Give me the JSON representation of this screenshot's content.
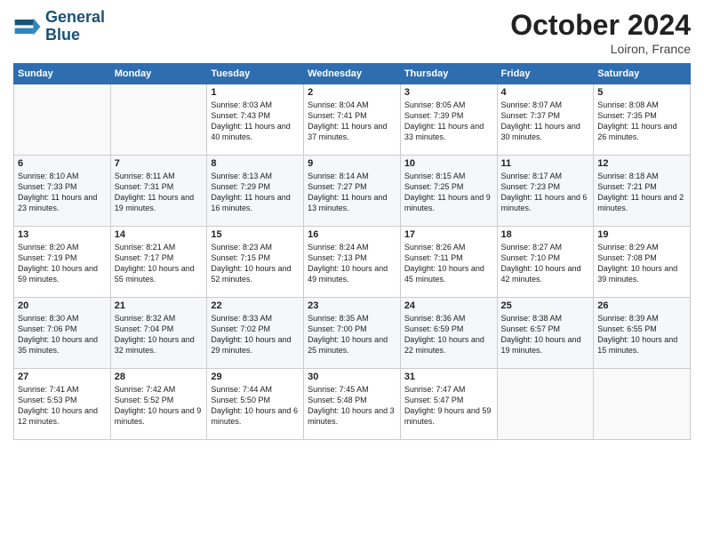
{
  "header": {
    "logo_line1": "General",
    "logo_line2": "Blue",
    "month_title": "October 2024",
    "location": "Loiron, France"
  },
  "days_of_week": [
    "Sunday",
    "Monday",
    "Tuesday",
    "Wednesday",
    "Thursday",
    "Friday",
    "Saturday"
  ],
  "weeks": [
    [
      {
        "day": "",
        "info": ""
      },
      {
        "day": "",
        "info": ""
      },
      {
        "day": "1",
        "info": "Sunrise: 8:03 AM\nSunset: 7:43 PM\nDaylight: 11 hours and 40 minutes."
      },
      {
        "day": "2",
        "info": "Sunrise: 8:04 AM\nSunset: 7:41 PM\nDaylight: 11 hours and 37 minutes."
      },
      {
        "day": "3",
        "info": "Sunrise: 8:05 AM\nSunset: 7:39 PM\nDaylight: 11 hours and 33 minutes."
      },
      {
        "day": "4",
        "info": "Sunrise: 8:07 AM\nSunset: 7:37 PM\nDaylight: 11 hours and 30 minutes."
      },
      {
        "day": "5",
        "info": "Sunrise: 8:08 AM\nSunset: 7:35 PM\nDaylight: 11 hours and 26 minutes."
      }
    ],
    [
      {
        "day": "6",
        "info": "Sunrise: 8:10 AM\nSunset: 7:33 PM\nDaylight: 11 hours and 23 minutes."
      },
      {
        "day": "7",
        "info": "Sunrise: 8:11 AM\nSunset: 7:31 PM\nDaylight: 11 hours and 19 minutes."
      },
      {
        "day": "8",
        "info": "Sunrise: 8:13 AM\nSunset: 7:29 PM\nDaylight: 11 hours and 16 minutes."
      },
      {
        "day": "9",
        "info": "Sunrise: 8:14 AM\nSunset: 7:27 PM\nDaylight: 11 hours and 13 minutes."
      },
      {
        "day": "10",
        "info": "Sunrise: 8:15 AM\nSunset: 7:25 PM\nDaylight: 11 hours and 9 minutes."
      },
      {
        "day": "11",
        "info": "Sunrise: 8:17 AM\nSunset: 7:23 PM\nDaylight: 11 hours and 6 minutes."
      },
      {
        "day": "12",
        "info": "Sunrise: 8:18 AM\nSunset: 7:21 PM\nDaylight: 11 hours and 2 minutes."
      }
    ],
    [
      {
        "day": "13",
        "info": "Sunrise: 8:20 AM\nSunset: 7:19 PM\nDaylight: 10 hours and 59 minutes."
      },
      {
        "day": "14",
        "info": "Sunrise: 8:21 AM\nSunset: 7:17 PM\nDaylight: 10 hours and 55 minutes."
      },
      {
        "day": "15",
        "info": "Sunrise: 8:23 AM\nSunset: 7:15 PM\nDaylight: 10 hours and 52 minutes."
      },
      {
        "day": "16",
        "info": "Sunrise: 8:24 AM\nSunset: 7:13 PM\nDaylight: 10 hours and 49 minutes."
      },
      {
        "day": "17",
        "info": "Sunrise: 8:26 AM\nSunset: 7:11 PM\nDaylight: 10 hours and 45 minutes."
      },
      {
        "day": "18",
        "info": "Sunrise: 8:27 AM\nSunset: 7:10 PM\nDaylight: 10 hours and 42 minutes."
      },
      {
        "day": "19",
        "info": "Sunrise: 8:29 AM\nSunset: 7:08 PM\nDaylight: 10 hours and 39 minutes."
      }
    ],
    [
      {
        "day": "20",
        "info": "Sunrise: 8:30 AM\nSunset: 7:06 PM\nDaylight: 10 hours and 35 minutes."
      },
      {
        "day": "21",
        "info": "Sunrise: 8:32 AM\nSunset: 7:04 PM\nDaylight: 10 hours and 32 minutes."
      },
      {
        "day": "22",
        "info": "Sunrise: 8:33 AM\nSunset: 7:02 PM\nDaylight: 10 hours and 29 minutes."
      },
      {
        "day": "23",
        "info": "Sunrise: 8:35 AM\nSunset: 7:00 PM\nDaylight: 10 hours and 25 minutes."
      },
      {
        "day": "24",
        "info": "Sunrise: 8:36 AM\nSunset: 6:59 PM\nDaylight: 10 hours and 22 minutes."
      },
      {
        "day": "25",
        "info": "Sunrise: 8:38 AM\nSunset: 6:57 PM\nDaylight: 10 hours and 19 minutes."
      },
      {
        "day": "26",
        "info": "Sunrise: 8:39 AM\nSunset: 6:55 PM\nDaylight: 10 hours and 15 minutes."
      }
    ],
    [
      {
        "day": "27",
        "info": "Sunrise: 7:41 AM\nSunset: 5:53 PM\nDaylight: 10 hours and 12 minutes."
      },
      {
        "day": "28",
        "info": "Sunrise: 7:42 AM\nSunset: 5:52 PM\nDaylight: 10 hours and 9 minutes."
      },
      {
        "day": "29",
        "info": "Sunrise: 7:44 AM\nSunset: 5:50 PM\nDaylight: 10 hours and 6 minutes."
      },
      {
        "day": "30",
        "info": "Sunrise: 7:45 AM\nSunset: 5:48 PM\nDaylight: 10 hours and 3 minutes."
      },
      {
        "day": "31",
        "info": "Sunrise: 7:47 AM\nSunset: 5:47 PM\nDaylight: 9 hours and 59 minutes."
      },
      {
        "day": "",
        "info": ""
      },
      {
        "day": "",
        "info": ""
      }
    ]
  ]
}
